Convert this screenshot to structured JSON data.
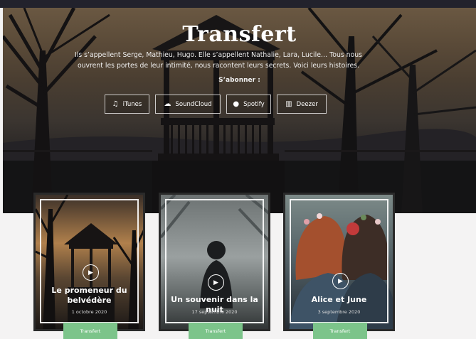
{
  "hero": {
    "title": "Transfert",
    "description": "Ils s’appellent Serge, Mathieu, Hugo. Elle s’appellent Nathalie, Lara, Lucile… Tous nous ouvrent les portes de leur intimité, nous racontent leurs secrets. Voici leurs histoires.",
    "subscribe_label": "S’abonner :",
    "platforms": [
      {
        "label": "iTunes",
        "icon": "music-note-icon"
      },
      {
        "label": "SoundCloud",
        "icon": "soundcloud-icon"
      },
      {
        "label": "Spotify",
        "icon": "spotify-icon"
      },
      {
        "label": "Deezer",
        "icon": "deezer-icon"
      }
    ]
  },
  "episodes": [
    {
      "title": "Le promeneur du belvédère",
      "date": "1 octobre 2020",
      "badge": "Transfert"
    },
    {
      "title": "Un souvenir dans la nuit",
      "date": "17 septembre 2020",
      "badge": "Transfert"
    },
    {
      "title": "Alice et June",
      "date": "3 septembre 2020",
      "badge": "Transfert"
    }
  ],
  "colors": {
    "badge": "#7cc48a",
    "topbar": "#22222c",
    "page_bg": "#f4f3f3"
  }
}
